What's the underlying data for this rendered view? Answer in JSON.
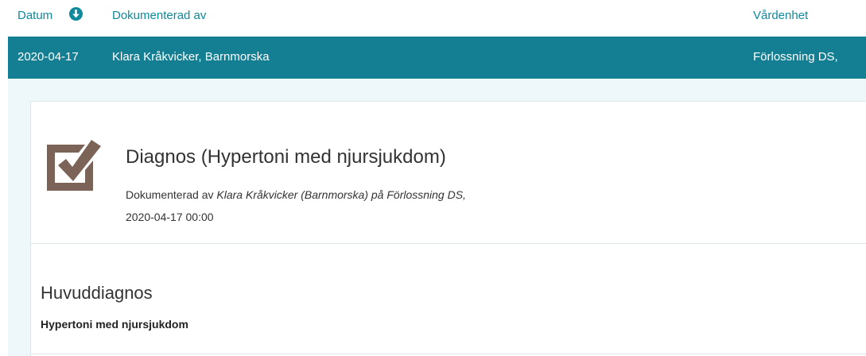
{
  "table_header": {
    "datum_label": "Datum",
    "sort_icon": "arrow-down-circle-icon",
    "documented_by_label": "Dokumenterad av",
    "unit_label": "Vårdenhet"
  },
  "selected_row": {
    "date": "2020-04-17",
    "author": "Klara Kråkvicker, Barnmorska",
    "unit": "Förlossning DS,"
  },
  "detail": {
    "icon": "checkbox-checked-icon",
    "title": "Diagnos (Hypertoni med njursjukdom)",
    "meta_prefix": "Dokumenterad av ",
    "meta_author": "Klara Kråkvicker (Barnmorska) på Förlossning DS,",
    "meta_datetime": "2020-04-17 00:00",
    "section_heading": "Huvuddiagnos",
    "section_value": "Hypertoni med njursjukdom"
  },
  "colors": {
    "accent": "#147f92",
    "link": "#0e8a9c",
    "panel_bg": "#eef7f9",
    "icon": "#7b6358"
  }
}
